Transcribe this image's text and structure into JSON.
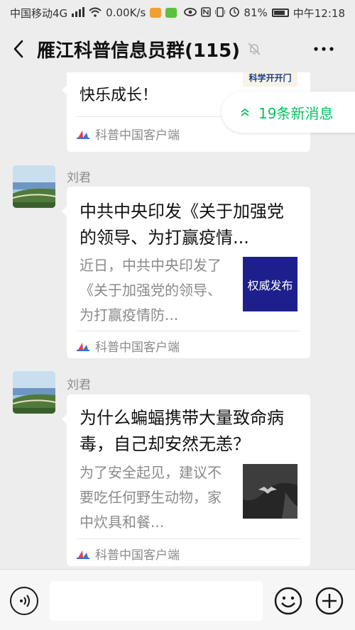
{
  "status_bar": {
    "carrier": "中国移动4G",
    "signal_badge": "4G",
    "speed": "0.00K/s",
    "battery": "81%",
    "time": "中午12:18"
  },
  "header": {
    "title": "雁江科普信息员群(115)"
  },
  "new_messages": {
    "label": "19条新消息"
  },
  "messages": [
    {
      "partial_top_text": "快乐成长！",
      "thumb_caption": "科学开开门",
      "source": "科普中国客户端"
    },
    {
      "sender": "刘君",
      "title": "中共中央印发《关于加强党的领导、为打赢疫情...",
      "desc": "近日，中共中央印发了《关于加强党的领导、为打赢疫情防...",
      "thumb_text": "权威发布",
      "source": "科普中国客户端"
    },
    {
      "sender": "刘君",
      "title": "为什么蝙蝠携带大量致命病毒，自己却安然无恙？",
      "desc": "为了安全起见，建议不要吃任何野生动物，家中炊具和餐...",
      "source": "科普中国客户端"
    }
  ],
  "colors": {
    "accent_green": "#07c160",
    "authority_blue": "#1d1f8c",
    "background": "#ededed"
  },
  "icons": {
    "back": "chevron-left-icon",
    "mute": "bell-off-icon",
    "more": "ellipsis-icon",
    "voice": "voice-icon",
    "emoji": "smiley-icon",
    "plus": "plus-icon"
  }
}
